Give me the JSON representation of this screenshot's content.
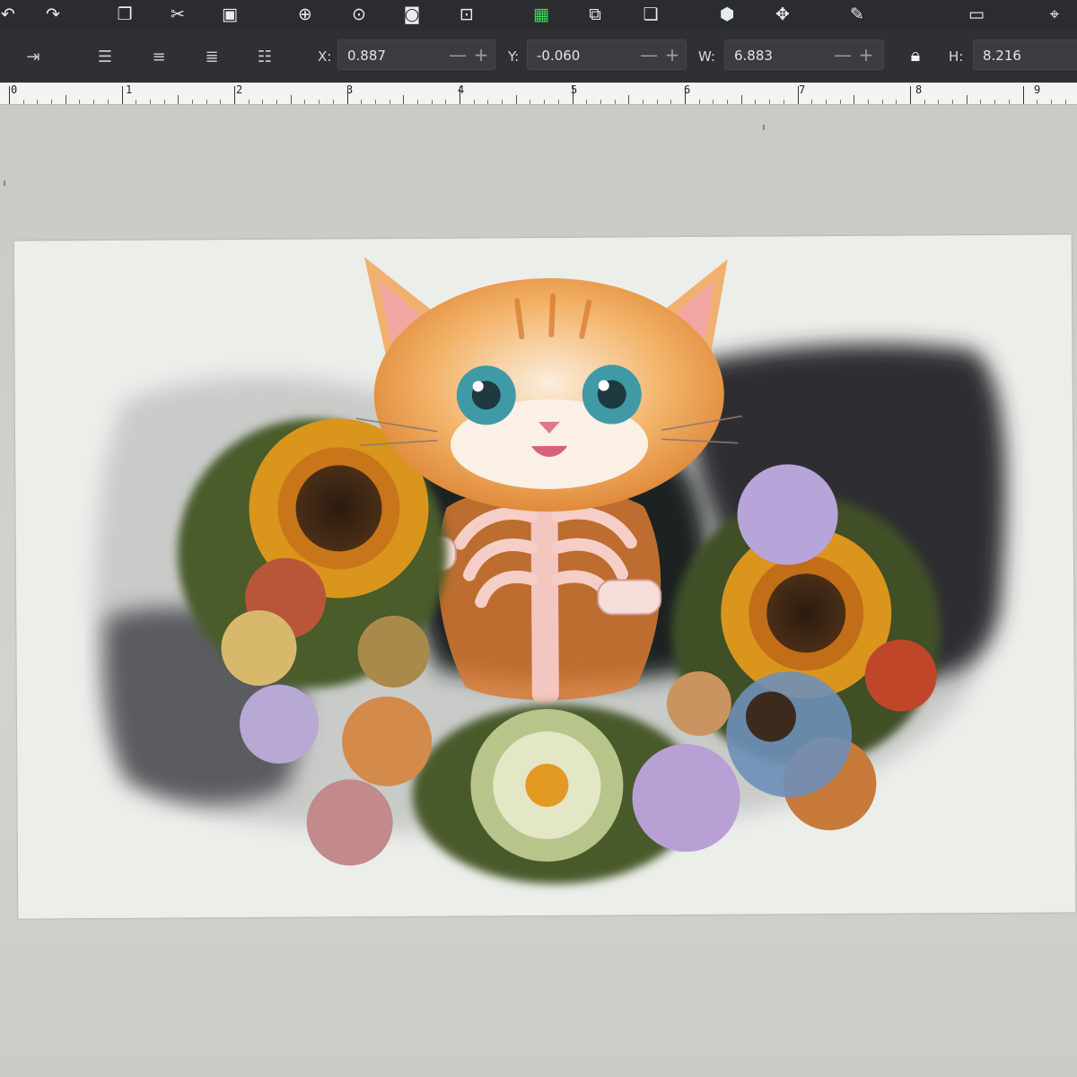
{
  "toolbar": {
    "commands": [
      {
        "name": "undo-icon",
        "glyph": "↶"
      },
      {
        "name": "redo-icon",
        "glyph": "↷"
      },
      {
        "name": "copy-icon",
        "glyph": "❐"
      },
      {
        "name": "cut-icon",
        "glyph": "✂"
      },
      {
        "name": "paste-icon",
        "glyph": "▣"
      },
      {
        "name": "zoom-selection-icon",
        "glyph": "⊕"
      },
      {
        "name": "zoom-drawing-icon",
        "glyph": "⊙"
      },
      {
        "name": "zoom-page-icon",
        "glyph": "◙"
      },
      {
        "name": "zoom-fit-icon",
        "glyph": "⊡"
      },
      {
        "name": "group-icon",
        "glyph": "▦"
      },
      {
        "name": "ungroup-icon",
        "glyph": "⧉"
      },
      {
        "name": "clone-icon",
        "glyph": "❏"
      },
      {
        "name": "fill-stroke-icon",
        "glyph": "⬢"
      },
      {
        "name": "transform-icon",
        "glyph": "✥"
      },
      {
        "name": "pen-icon",
        "glyph": "✎"
      },
      {
        "name": "text-icon",
        "glyph": "▭"
      },
      {
        "name": "node-icon",
        "glyph": "⌖"
      }
    ]
  },
  "controls": {
    "icons": [
      {
        "name": "flip-icon",
        "glyph": "⇥"
      },
      {
        "name": "raise-top-icon",
        "glyph": "☰"
      },
      {
        "name": "raise-icon",
        "glyph": "≡"
      },
      {
        "name": "lower-icon",
        "glyph": "≣"
      },
      {
        "name": "lower-bottom-icon",
        "glyph": "☷"
      }
    ],
    "x": {
      "label": "X:",
      "value": "0.887"
    },
    "y": {
      "label": "Y:",
      "value": "-0.060"
    },
    "w": {
      "label": "W:",
      "value": "6.883"
    },
    "h": {
      "label": "H:",
      "value": "8.216"
    },
    "minus": "—",
    "plus": "+"
  },
  "ruler": {
    "labels": [
      "0",
      "1",
      "2",
      "3",
      "4",
      "5",
      "6",
      "7",
      "8",
      "9"
    ]
  },
  "colors": {
    "toolbar_bg": "#2b2c30",
    "canvas_bg": "#cfd0cc",
    "page_bg": "#eceeea",
    "accent_green": "#3fd75a"
  }
}
